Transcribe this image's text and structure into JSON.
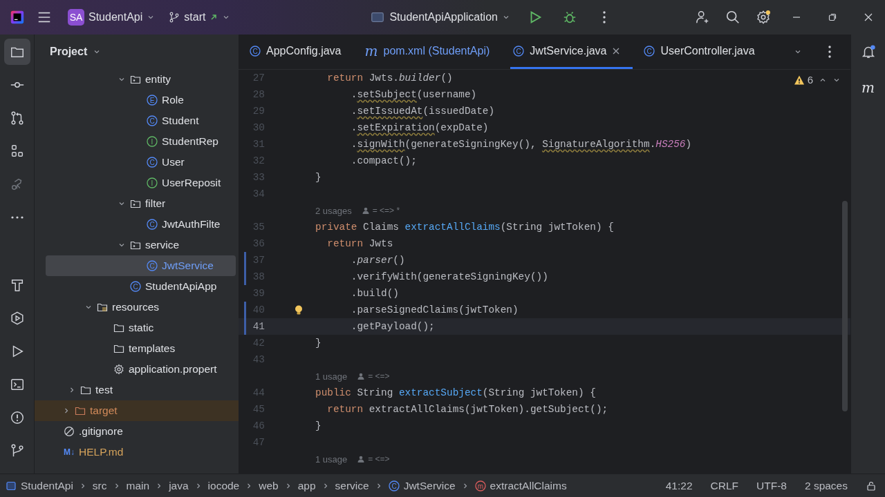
{
  "title_bar": {
    "project_badge": "SA",
    "project": "StudentApi",
    "branch": "start",
    "run_config": "StudentApiApplication",
    "settings_notice": true
  },
  "tool_strip": {
    "top": [
      {
        "kind": "folder",
        "selected": true
      },
      {
        "kind": "commit",
        "selected": false
      },
      {
        "kind": "pull-requests",
        "selected": false
      },
      {
        "kind": "structure",
        "selected": false
      },
      {
        "kind": "inspect",
        "selected": false
      },
      {
        "kind": "more",
        "selected": false
      }
    ],
    "bottom": [
      {
        "kind": "build",
        "selected": false
      },
      {
        "kind": "services",
        "selected": false
      },
      {
        "kind": "run",
        "selected": false
      },
      {
        "kind": "terminal",
        "selected": false
      },
      {
        "kind": "problems",
        "selected": false
      },
      {
        "kind": "git",
        "selected": false
      }
    ]
  },
  "project_panel": {
    "title": "Project",
    "tree": [
      {
        "children": [
          {
            "children": [
              {
                "children": [
                  {
                    "children": [
                      {
                        "label": "entity",
                        "kind": "package",
                        "expanded": true,
                        "selected": false,
                        "children": [
                          {
                            "label": "Role",
                            "kind": "enum",
                            "badge": "E",
                            "selected": false
                          },
                          {
                            "label": "Student",
                            "kind": "class",
                            "badge": "C",
                            "selected": false
                          },
                          {
                            "label": "StudentRep",
                            "kind": "interface",
                            "badge": "I",
                            "selected": false
                          },
                          {
                            "label": "User",
                            "kind": "class",
                            "badge": "C",
                            "selected": false
                          },
                          {
                            "label": "UserReposit",
                            "kind": "interface",
                            "badge": "I",
                            "selected": false
                          }
                        ]
                      },
                      {
                        "label": "filter",
                        "kind": "package",
                        "expanded": true,
                        "selected": false,
                        "children": [
                          {
                            "label": "JwtAuthFilte",
                            "kind": "class",
                            "badge": "C",
                            "selected": false
                          }
                        ]
                      },
                      {
                        "label": "service",
                        "kind": "package",
                        "expanded": true,
                        "selected": false,
                        "children": [
                          {
                            "label": "JwtService",
                            "kind": "class",
                            "badge": "C",
                            "selected": true
                          }
                        ]
                      },
                      {
                        "label": "StudentApiApp",
                        "kind": "class",
                        "badge": "C",
                        "selected": false
                      }
                    ]
                  }
                ]
              },
              {
                "label": "resources",
                "kind": "resources",
                "expanded": true,
                "selected": false,
                "children": [
                  {
                    "label": "static",
                    "kind": "folder",
                    "selected": false
                  },
                  {
                    "label": "templates",
                    "kind": "folder",
                    "selected": false
                  },
                  {
                    "label": "application.propert",
                    "kind": "settings",
                    "selected": false
                  }
                ]
              }
            ]
          },
          {
            "label": "test",
            "kind": "folder",
            "expanded": false,
            "selected": false
          }
        ]
      },
      {
        "label": "target",
        "kind": "excluded-folder",
        "expanded": false,
        "selected": false
      },
      {
        "label": ".gitignore",
        "kind": "ignore",
        "selected": false
      },
      {
        "label": "HELP.md",
        "kind": "markdown",
        "badge": "M↓",
        "selected": false
      }
    ]
  },
  "editor": {
    "tabs": [
      {
        "label": "AppConfig.java",
        "kind": "class",
        "badge": "C",
        "modified": false,
        "selected": false,
        "closable": false
      },
      {
        "label": "pom.xml (StudentApi)",
        "kind": "maven",
        "badge": "m",
        "modified": true,
        "selected": false,
        "closable": false
      },
      {
        "label": "JwtService.java",
        "kind": "class",
        "badge": "C",
        "modified": false,
        "selected": true,
        "closable": true
      },
      {
        "label": "UserController.java",
        "kind": "class",
        "badge": "C",
        "modified": false,
        "selected": false,
        "closable": false
      }
    ],
    "problems": "6",
    "lines": [
      {
        "kind": "code",
        "number": "27",
        "modified": false,
        "current": false,
        "bulb": false,
        "tokens": [
          {
            "text": "  return",
            "kind": "keyword"
          },
          {
            "text": " Jwts.",
            "kind": "plain"
          },
          {
            "text": "builder",
            "kind": "static-call"
          },
          {
            "text": "()",
            "kind": "plain"
          }
        ]
      },
      {
        "kind": "code",
        "number": "28",
        "modified": false,
        "current": false,
        "bulb": false,
        "tokens": [
          {
            "text": "      .",
            "kind": "plain"
          },
          {
            "text": "setSubject",
            "kind": "deprecated"
          },
          {
            "text": "(username)",
            "kind": "plain"
          }
        ]
      },
      {
        "kind": "code",
        "number": "29",
        "modified": false,
        "current": false,
        "bulb": false,
        "tokens": [
          {
            "text": "      .",
            "kind": "plain"
          },
          {
            "text": "setIssuedAt",
            "kind": "deprecated"
          },
          {
            "text": "(issuedDate)",
            "kind": "plain"
          }
        ]
      },
      {
        "kind": "code",
        "number": "30",
        "modified": false,
        "current": false,
        "bulb": false,
        "tokens": [
          {
            "text": "      .",
            "kind": "plain"
          },
          {
            "text": "setExpiration",
            "kind": "deprecated"
          },
          {
            "text": "(expDate)",
            "kind": "plain"
          }
        ]
      },
      {
        "kind": "code",
        "number": "31",
        "modified": false,
        "current": false,
        "bulb": false,
        "tokens": [
          {
            "text": "      .",
            "kind": "plain"
          },
          {
            "text": "signWith",
            "kind": "deprecated"
          },
          {
            "text": "(generateSigningKey(), ",
            "kind": "plain"
          },
          {
            "text": "SignatureAlgorithm",
            "kind": "deprecated"
          },
          {
            "text": ".",
            "kind": "plain"
          },
          {
            "text": "HS256",
            "kind": "constant"
          },
          {
            "text": ")",
            "kind": "plain"
          }
        ]
      },
      {
        "kind": "code",
        "number": "32",
        "modified": false,
        "current": false,
        "bulb": false,
        "tokens": [
          {
            "text": "      .compact();",
            "kind": "plain"
          }
        ]
      },
      {
        "kind": "code",
        "number": "33",
        "modified": false,
        "current": false,
        "bulb": false,
        "tokens": [
          {
            "text": "}",
            "kind": "plain"
          }
        ]
      },
      {
        "kind": "code",
        "number": "34",
        "modified": false,
        "current": false,
        "bulb": false
      },
      {
        "kind": "hint",
        "usages": "2 usages",
        "authors": "= <=> *"
      },
      {
        "kind": "code",
        "number": "35",
        "modified": false,
        "current": false,
        "bulb": false,
        "tokens": [
          {
            "text": "private",
            "kind": "keyword"
          },
          {
            "text": " Claims ",
            "kind": "plain"
          },
          {
            "text": "extractAllClaims",
            "kind": "declaration"
          },
          {
            "text": "(String jwtToken) {",
            "kind": "plain"
          }
        ]
      },
      {
        "kind": "code",
        "number": "36",
        "modified": false,
        "current": false,
        "bulb": false,
        "tokens": [
          {
            "text": "  return",
            "kind": "keyword"
          },
          {
            "text": " Jwts",
            "kind": "plain"
          }
        ]
      },
      {
        "kind": "code",
        "number": "37",
        "modified": true,
        "current": false,
        "bulb": false,
        "tokens": [
          {
            "text": "      .",
            "kind": "plain"
          },
          {
            "text": "parser",
            "kind": "static-call"
          },
          {
            "text": "()",
            "kind": "plain"
          }
        ]
      },
      {
        "kind": "code",
        "number": "38",
        "modified": true,
        "current": false,
        "bulb": false,
        "tokens": [
          {
            "text": "      .verifyWith(generateSigningKey())",
            "kind": "plain"
          }
        ]
      },
      {
        "kind": "code",
        "number": "39",
        "modified": false,
        "current": false,
        "bulb": false,
        "tokens": [
          {
            "text": "      .build()",
            "kind": "plain"
          }
        ]
      },
      {
        "kind": "code",
        "number": "40",
        "modified": true,
        "current": false,
        "bulb": true,
        "tokens": [
          {
            "text": "      .parseSignedClaims(jwtToken)",
            "kind": "plain"
          }
        ]
      },
      {
        "kind": "code",
        "number": "41",
        "modified": true,
        "current": true,
        "bulb": false,
        "tokens": [
          {
            "text": "      .getPayload();",
            "kind": "plain"
          }
        ]
      },
      {
        "kind": "code",
        "number": "42",
        "modified": false,
        "current": false,
        "bulb": false,
        "tokens": [
          {
            "text": "}",
            "kind": "plain"
          }
        ]
      },
      {
        "kind": "code",
        "number": "43",
        "modified": false,
        "current": false,
        "bulb": false
      },
      {
        "kind": "hint",
        "usages": "1 usage",
        "authors": "= <=>"
      },
      {
        "kind": "code",
        "number": "44",
        "modified": false,
        "current": false,
        "bulb": false,
        "tokens": [
          {
            "text": "public",
            "kind": "keyword"
          },
          {
            "text": " String ",
            "kind": "plain"
          },
          {
            "text": "extractSubject",
            "kind": "declaration"
          },
          {
            "text": "(String jwtToken) {",
            "kind": "plain"
          }
        ]
      },
      {
        "kind": "code",
        "number": "45",
        "modified": false,
        "current": false,
        "bulb": false,
        "tokens": [
          {
            "text": "  return",
            "kind": "keyword"
          },
          {
            "text": " extractAllClaims(jwtToken).getSubject();",
            "kind": "plain"
          }
        ]
      },
      {
        "kind": "code",
        "number": "46",
        "modified": false,
        "current": false,
        "bulb": false,
        "tokens": [
          {
            "text": "}",
            "kind": "plain"
          }
        ]
      },
      {
        "kind": "code",
        "number": "47",
        "modified": false,
        "current": false,
        "bulb": false
      },
      {
        "kind": "hint",
        "usages": "1 usage",
        "authors": "= <=>"
      }
    ]
  },
  "right_strip": {
    "notifications_unread": true,
    "maven_badge": "m"
  },
  "status_bar": {
    "breadcrumbs": [
      {
        "label": "StudentApi",
        "kind": "module"
      },
      {
        "label": "src",
        "kind": "plain"
      },
      {
        "label": "main",
        "kind": "plain"
      },
      {
        "label": "java",
        "kind": "plain"
      },
      {
        "label": "iocode",
        "kind": "plain"
      },
      {
        "label": "web",
        "kind": "plain"
      },
      {
        "label": "app",
        "kind": "plain"
      },
      {
        "label": "service",
        "kind": "plain"
      },
      {
        "label": "JwtService",
        "kind": "class",
        "badge": "C"
      },
      {
        "label": "extractAllClaims",
        "kind": "method",
        "badge": "m"
      }
    ],
    "position": "41:22",
    "line_separator": "CRLF",
    "encoding": "UTF-8",
    "indent": "2 spaces"
  }
}
